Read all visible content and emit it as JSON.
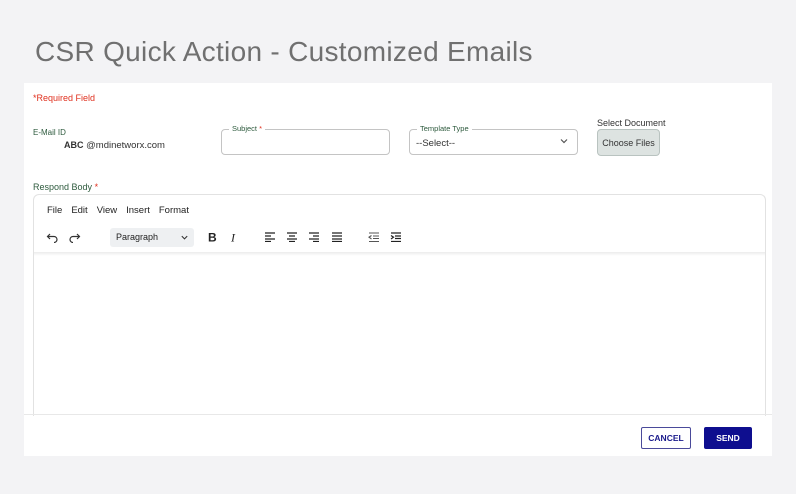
{
  "page": {
    "title": "CSR Quick Action - Customized Emails"
  },
  "form": {
    "required_note": "*Required Field",
    "email": {
      "label": "E-Mail ID",
      "prefix": "ABC",
      "value": "@mdinetworx.com"
    },
    "subject": {
      "label": "Subject",
      "required_mark": "*",
      "value": ""
    },
    "template_type": {
      "label": "Template Type",
      "selected": "--Select--"
    },
    "document": {
      "label": "Select Document",
      "button": "Choose Files"
    },
    "respond_body": {
      "label": "Respond Body",
      "required_mark": "*"
    }
  },
  "editor": {
    "menu": [
      "File",
      "Edit",
      "View",
      "Insert",
      "Format"
    ],
    "block_format": "Paragraph",
    "toolbar_icons": [
      "undo-icon",
      "redo-icon",
      "bold-icon",
      "italic-icon",
      "align-left-icon",
      "align-center-icon",
      "align-right-icon",
      "align-justify-icon",
      "outdent-icon",
      "indent-icon"
    ],
    "content": ""
  },
  "actions": {
    "cancel": "CANCEL",
    "send": "SEND"
  },
  "colors": {
    "required": "#e0301e",
    "label_green": "#2d5a3d",
    "primary": "#0e0e8f"
  }
}
